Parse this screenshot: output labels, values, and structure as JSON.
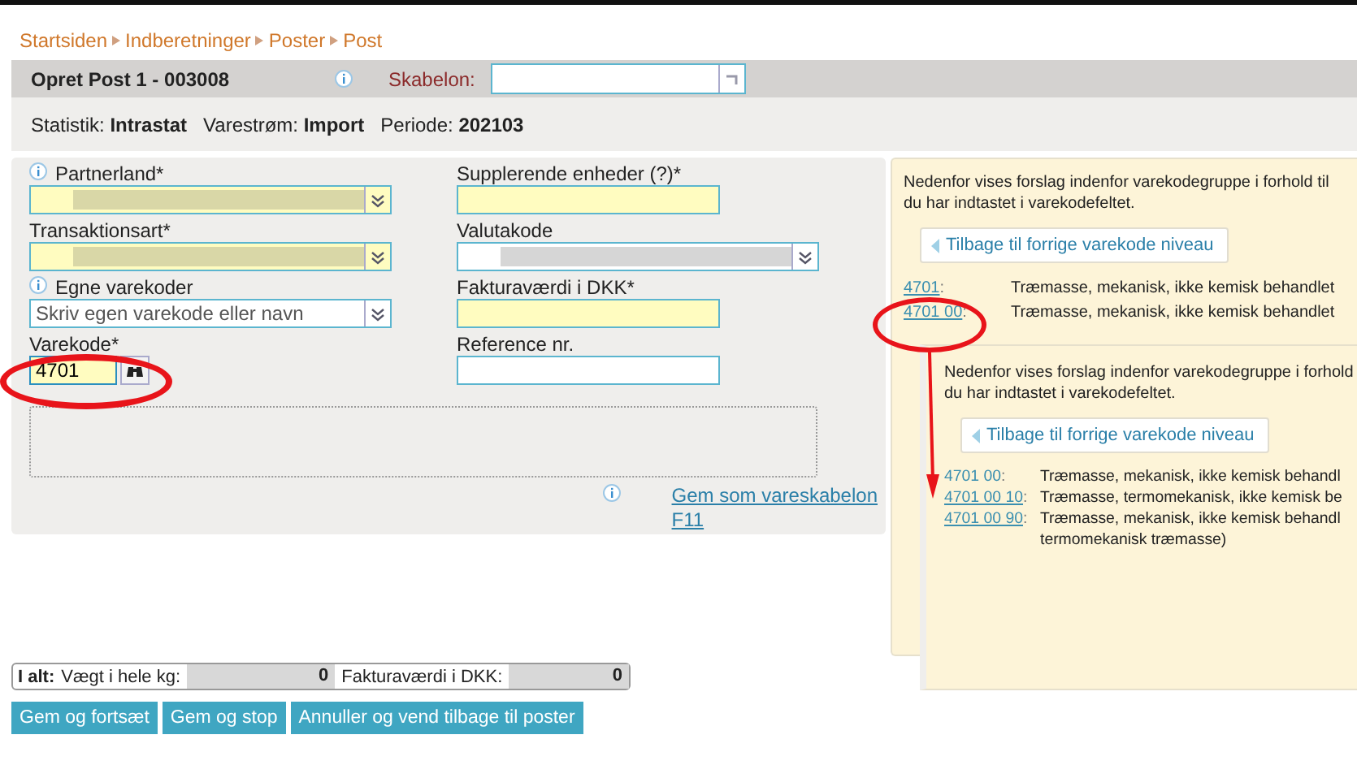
{
  "breadcrumb": [
    "Startsiden",
    "Indberetninger",
    "Poster",
    "Post"
  ],
  "header": {
    "title": "Opret Post 1 - 003008",
    "template_label": "Skabelon:"
  },
  "stats": [
    "Statistik: **Intrastat**",
    "Varestrøm: **Import**",
    "Periode: **202103**"
  ],
  "form": {
    "left": [
      {
        "kind": "select",
        "label": "Partnerland*",
        "info": true,
        "mandatory": true
      },
      {
        "kind": "select",
        "label": "Transaktionsart*",
        "info": false,
        "mandatory": true
      },
      {
        "kind": "select",
        "label": "Egne varekoder",
        "info": true,
        "mandatory": false,
        "placeholder": "Skriv egen varekode eller navn"
      },
      {
        "kind": "code",
        "label": "Varekode*",
        "info": false,
        "mandatory": true,
        "value": "4701"
      }
    ],
    "right": [
      {
        "kind": "input",
        "label": "Supplerende enheder (?)*",
        "mandatory": true
      },
      {
        "kind": "select",
        "label": "Valutakode",
        "mandatory": false
      },
      {
        "kind": "input",
        "label": "Fakturaværdi i DKK*",
        "mandatory": true
      },
      {
        "kind": "input",
        "label": "Reference nr.",
        "mandatory": false
      }
    ],
    "save_link": [
      "Gem som vareskabelon",
      "F11"
    ]
  },
  "suggestions": {
    "intro": [
      "Nedenfor vises forslag indenfor varekodegruppe i forhold til",
      "du har indtastet i varekodefeltet."
    ],
    "back": "Tilbage til forrige varekode niveau",
    "rows": [
      {
        "code": "4701",
        "punct": ":",
        "linked": true,
        "lines": [
          "Træmasse, mekanisk, ikke kemisk behandlet"
        ]
      },
      {
        "code": "4701 00",
        "punct": ":",
        "linked": true,
        "lines": [
          "Træmasse, mekanisk, ikke kemisk behandlet"
        ]
      }
    ],
    "nested": {
      "intro": [
        "Nedenfor vises forslag indenfor varekodegruppe i forhold",
        "du har indtastet i varekodefeltet."
      ],
      "back": "Tilbage til forrige varekode niveau",
      "rows": [
        {
          "code": "4701 00",
          "punct": ":",
          "linked": false,
          "lines": [
            "Træmasse, mekanisk, ikke kemisk behandl"
          ]
        },
        {
          "code": "4701 00 10",
          "punct": ":",
          "linked": true,
          "lines": [
            "Træmasse, termomekanisk, ikke kemisk be"
          ]
        },
        {
          "code": "4701 00 90",
          "punct": ":",
          "linked": true,
          "lines": [
            "Træmasse, mekanisk, ikke kemisk behandl",
            "termomekanisk træmasse)"
          ]
        }
      ]
    }
  },
  "totals": {
    "label": "I alt:",
    "weight_label": "Vægt i hele kg:",
    "weight": "0",
    "value_label": "Fakturaværdi i DKK:",
    "value": "0"
  },
  "buttons": [
    "Gem og fortsæt",
    "Gem og stop",
    "Annuller og vend tilbage til poster"
  ]
}
